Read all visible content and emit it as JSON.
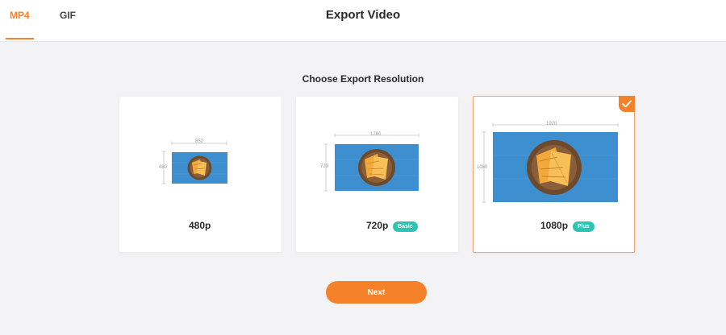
{
  "tabs": [
    {
      "label": "MP4",
      "active": true
    },
    {
      "label": "GIF",
      "active": false
    }
  ],
  "title": "Export Video",
  "section_title": "Choose Export Resolution",
  "options": [
    {
      "label": "480p",
      "width": "852",
      "height": "480",
      "badge": null,
      "selected": false
    },
    {
      "label": "720p",
      "width": "1280",
      "height": "720",
      "badge": "Basic",
      "selected": false
    },
    {
      "label": "1080p",
      "width": "1920",
      "height": "1080",
      "badge": "Plus",
      "selected": true
    }
  ],
  "next_label": "Next",
  "icons": {
    "selected": "checkmark-icon",
    "thumbnail": "sandwich-plate-thumbnail"
  },
  "colors": {
    "accent": "#f5822a",
    "badge": "#2cc5b4",
    "thumbnail_bg": "#3d8fd0"
  }
}
